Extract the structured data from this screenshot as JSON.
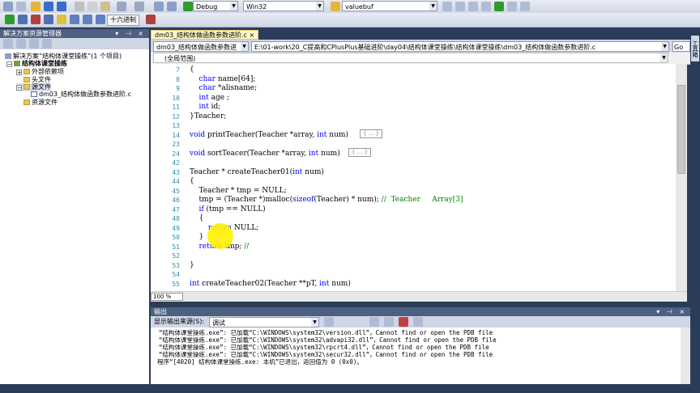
{
  "toolbar": {
    "config": "Debug",
    "platform": "Win32",
    "find_box": "valuebuf",
    "hex_label": "十六进制",
    "colors": {
      "play": "#2e9b2e",
      "save": "#3a6cc8",
      "open": "#e6b53c"
    }
  },
  "solution_explorer": {
    "title": "解决方案资源管理器",
    "title_controls": "▾ ⊣ ×",
    "items": [
      {
        "label": "解决方案“结构体课堂操练”(1 个项目)"
      },
      {
        "label": "结构体课堂操练"
      },
      {
        "label": "外部依赖项"
      },
      {
        "label": "头文件"
      },
      {
        "label": "源文件"
      },
      {
        "label": "dm03_结构体做函数参数进阶.c"
      },
      {
        "label": "资源文件"
      }
    ]
  },
  "editor": {
    "tab_label": "dm03_结构体做函数参数进阶.c",
    "tab_close": "×",
    "nav_left": "dm03_结构体做函数参数进",
    "nav_path": "E:\\01-work\\20_C提高和CPlusPlus基础进阶\\day04\\结构体课堂操练\\结构体课堂操练\\dm03_结构体做函数参数进阶.c",
    "nav_go": "Go",
    "scope": "(全局范围)",
    "zoom": "100 %",
    "collapsed_marker": "{ ... }",
    "lines": [
      {
        "n": "7",
        "code": "{"
      },
      {
        "n": "8",
        "code": "    char name[64];"
      },
      {
        "n": "9",
        "code": "    char *alisname;"
      },
      {
        "n": "10",
        "code": "    int age ;"
      },
      {
        "n": "11",
        "code": "    int id;"
      },
      {
        "n": "12",
        "code": "}Teacher;"
      },
      {
        "n": "13",
        "code": ""
      },
      {
        "n": "14",
        "code": "void printTeacher(Teacher *array, int num)"
      },
      {
        "n": "23",
        "code": ""
      },
      {
        "n": "24",
        "code": "void sortTeacer(Teacher *array, int num)"
      },
      {
        "n": "42",
        "code": ""
      },
      {
        "n": "43",
        "code": "Teacher * createTeacher01(int num)"
      },
      {
        "n": "44",
        "code": "{"
      },
      {
        "n": "45",
        "code": "    Teacher * tmp = NULL;"
      },
      {
        "n": "46",
        "code": "    tmp = (Teacher *)malloc(sizeof(Teacher) * num); //  Teacher     Array[3]"
      },
      {
        "n": "47",
        "code": "    if (tmp == NULL)"
      },
      {
        "n": "48",
        "code": "    {"
      },
      {
        "n": "49",
        "code": "        return NULL;"
      },
      {
        "n": "50",
        "code": "    }"
      },
      {
        "n": "51",
        "code": "    return tmp; //"
      },
      {
        "n": "52",
        "code": ""
      },
      {
        "n": "53",
        "code": "}"
      },
      {
        "n": "54",
        "code": ""
      },
      {
        "n": "55",
        "code": "int createTeacher02(Teacher **pT, int num)"
      }
    ]
  },
  "output": {
    "title": "输出",
    "source_label": "显示输出来源(S):",
    "source_value": "调试",
    "lines": [
      "“结构体课堂操练.exe”: 已加载“C:\\WINDOWS\\system32\\version.dll”，Cannot find or open the PDB file",
      "“结构体课堂操练.exe”: 已加载“C:\\WINDOWS\\system32\\advapi32.dll”，Cannot find or open the PDB file",
      "“结构体课堂操练.exe”: 已加载“C:\\WINDOWS\\system32\\rpcrt4.dll”，Cannot find or open the PDB file",
      "“结构体课堂操练.exe”: 已加载“C:\\WINDOWS\\system32\\secur32.dll”，Cannot find or open the PDB file",
      "程序“[4020] 结构体课堂操练.exe: 本机”已退出，返回值为 0 (0x0)。"
    ]
  },
  "right_strip": {
    "toolbox": "工具箱"
  }
}
